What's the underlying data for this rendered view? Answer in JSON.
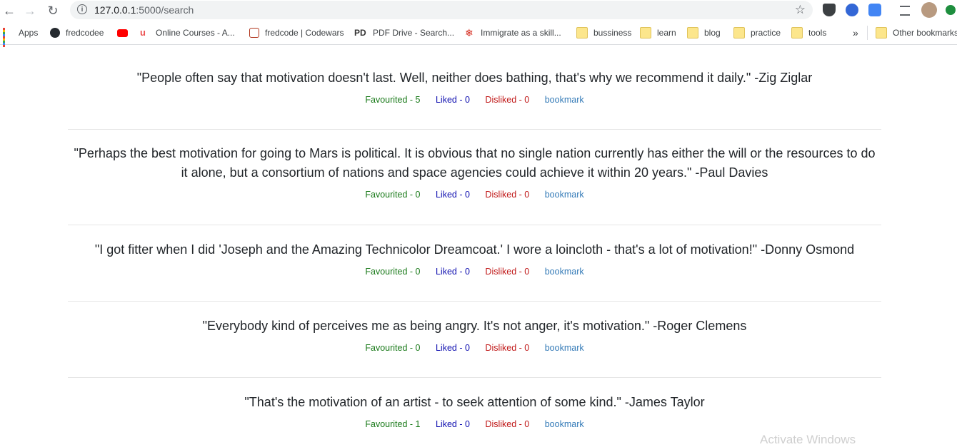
{
  "browser": {
    "url_host": "127.0.0.1",
    "url_rest": ":5000/search"
  },
  "bookmarks_bar": {
    "items": [
      {
        "label": "Apps",
        "icon": "apps-grid-icon"
      },
      {
        "label": "fredcodee",
        "icon": "github-icon"
      },
      {
        "label": "",
        "icon": "youtube-icon"
      },
      {
        "label": "Online Courses - A...",
        "icon": "udemy-icon"
      },
      {
        "label": "fredcode | Codewars",
        "icon": "codewars-icon"
      },
      {
        "label": "PDF Drive - Search...",
        "icon": "pdfdrive-icon"
      },
      {
        "label": "Immigrate as a skill...",
        "icon": "maple-leaf-icon"
      },
      {
        "label": "bussiness",
        "icon": "folder-icon"
      },
      {
        "label": "learn",
        "icon": "folder-icon"
      },
      {
        "label": "blog",
        "icon": "folder-icon"
      },
      {
        "label": "practice",
        "icon": "folder-icon"
      },
      {
        "label": "tools",
        "icon": "folder-icon"
      }
    ],
    "overflow": "»",
    "other": "Other bookmarks"
  },
  "quotes": [
    {
      "text": "\"People often say that motivation doesn't last. Well, neither does bathing, that's why we recommend it daily.\" -Zig Ziglar",
      "favourited": "Favourited - 5",
      "liked": "Liked - 0",
      "disliked": "Disliked - 0",
      "bookmark": "bookmark"
    },
    {
      "text": "\"Perhaps the best motivation for going to Mars is political. It is obvious that no single nation currently has either the will or the resources to do it alone, but a consortium of nations and space agencies could achieve it within 20 years.\" -Paul Davies",
      "favourited": "Favourited - 0",
      "liked": "Liked - 0",
      "disliked": "Disliked - 0",
      "bookmark": "bookmark"
    },
    {
      "text": "\"I got fitter when I did 'Joseph and the Amazing Technicolor Dreamcoat.' I wore a loincloth - that's a lot of motivation!\" -Donny Osmond",
      "favourited": "Favourited - 0",
      "liked": "Liked - 0",
      "disliked": "Disliked - 0",
      "bookmark": "bookmark"
    },
    {
      "text": "\"Everybody kind of perceives me as being angry. It's not anger, it's motivation.\" -Roger Clemens",
      "favourited": "Favourited - 0",
      "liked": "Liked - 0",
      "disliked": "Disliked - 0",
      "bookmark": "bookmark"
    },
    {
      "text": "\"That's the motivation of an artist - to seek attention of some kind.\" -James Taylor",
      "favourited": "Favourited - 1",
      "liked": "Liked - 0",
      "disliked": "Disliked - 0",
      "bookmark": "bookmark"
    }
  ],
  "colors": {
    "favourited": "#1a7a1a",
    "liked": "#1010b0",
    "disliked": "#c01818",
    "bookmark": "#337ab7"
  },
  "watermark": "Activate Windows"
}
